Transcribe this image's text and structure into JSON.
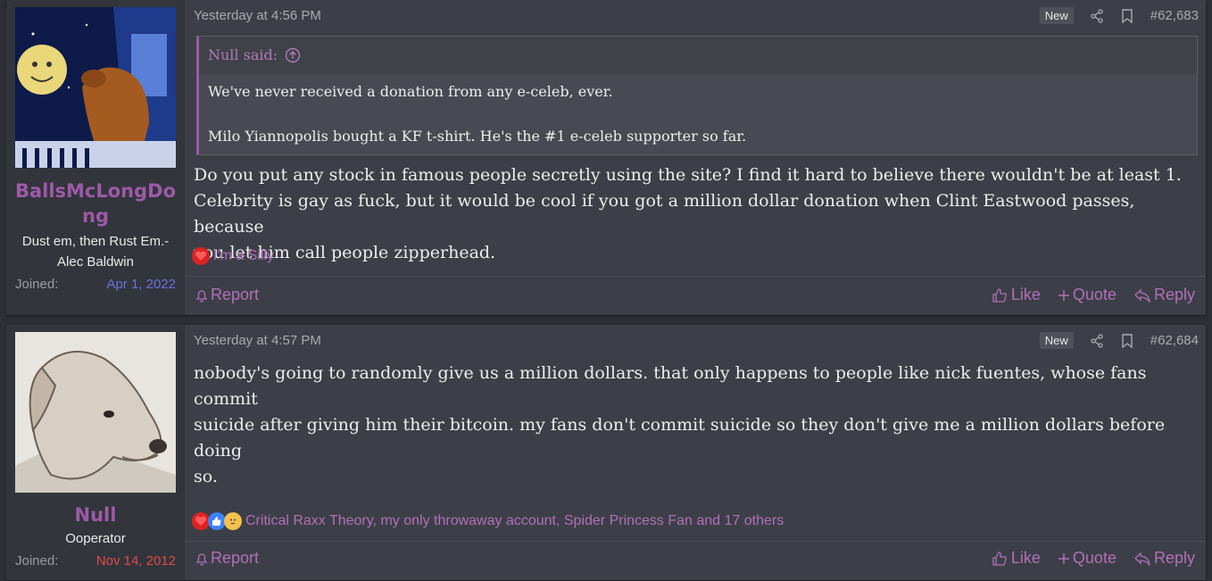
{
  "posts": [
    {
      "author": {
        "name_line1": "BallsMcLongDo",
        "name_line2": "ng",
        "title_line1": "Dust em, then Rust Em.-",
        "title_line2": "Alec Baldwin",
        "joined_label": "Joined:",
        "joined_date": "Apr 1, 2022",
        "joined_color": "#6b6fe0"
      },
      "timestamp": "Yesterday at 4:56 PM",
      "new_badge": "New",
      "post_number": "#62,683",
      "quote": {
        "author": "Null said:",
        "line1": "We've never received a donation from any e-celeb, ever.",
        "line2": "Milo Yiannopolis bought a KF t-shirt. He's the #1 e-celeb supporter so far."
      },
      "body_lines": [
        "Do you put any stock in famous people secretly using the site? I find it hard to believe there wouldn't be at least 1.",
        "Celebrity is gay as fuck, but it would be cool if you got a million dollar donation when Clint Eastwood passes, because",
        "you let him call people zipperhead."
      ],
      "reactions_text": "I'm a Silly",
      "actions": {
        "report": "Report",
        "like": "Like",
        "quote": "Quote",
        "reply": "Reply"
      }
    },
    {
      "author": {
        "name_line1": "Null",
        "title_line1": "Ooperator",
        "joined_label": "Joined:",
        "joined_date": "Nov 14, 2012",
        "joined_color": "#e04a4a"
      },
      "timestamp": "Yesterday at 4:57 PM",
      "new_badge": "New",
      "post_number": "#62,684",
      "body_lines": [
        "nobody's going to randomly give us a million dollars. that only happens to people like nick fuentes, whose fans commit",
        "suicide after giving him their bitcoin. my fans don't commit suicide so they don't give me a million dollars before doing",
        "so."
      ],
      "reactions_text": "Critical Raxx Theory, my only throwaway account, Spider Princess Fan and 17 others",
      "actions": {
        "report": "Report",
        "like": "Like",
        "quote": "Quote",
        "reply": "Reply"
      }
    }
  ],
  "colors": {
    "accent": "#9d5aa6",
    "link": "#b26fba",
    "background": "#2c2f36",
    "post_bg": "#3c3f47"
  },
  "icons": [
    "share-icon",
    "bookmark-icon",
    "bell-icon",
    "thumbs-up-icon",
    "plus-icon",
    "reply-icon",
    "arrow-up-circle-icon"
  ]
}
